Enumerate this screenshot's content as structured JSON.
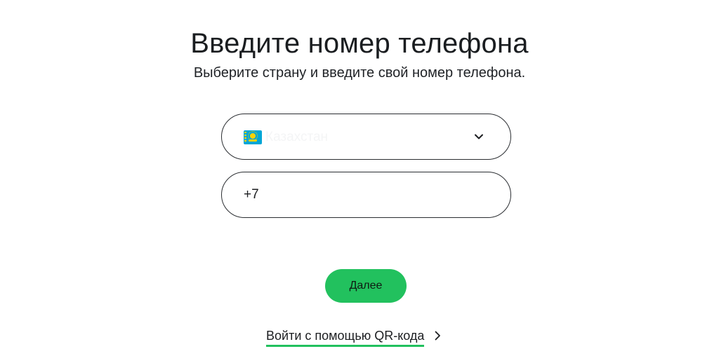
{
  "header": {
    "title": "Введите номер телефона",
    "subtitle": "Выберите страну и введите свой номер телефона."
  },
  "country_select": {
    "flag_icon": "flag-kazakhstan-icon",
    "selected_country": "Казахстан",
    "dropdown_icon": "chevron-down-icon"
  },
  "phone_field": {
    "value": "+7"
  },
  "next_button": {
    "label": "Далее",
    "color": "#22c15e"
  },
  "qr_login": {
    "label": "Войти с помощью QR-кода",
    "icon": "chevron-right-icon"
  },
  "colors": {
    "accent": "#22c15e",
    "border": "#2a2d31"
  }
}
